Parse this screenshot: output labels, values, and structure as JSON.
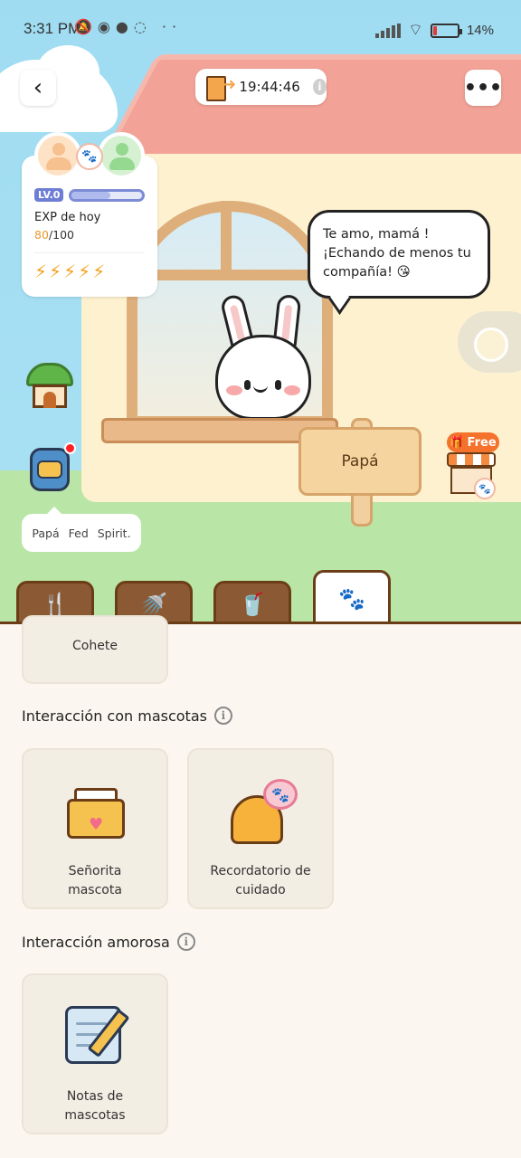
{
  "status_bar": {
    "time": "3:31 PM",
    "battery_text": "14%",
    "battery_level": 0.14
  },
  "header": {
    "timer": "19:44:46"
  },
  "profile": {
    "level": "LV.0",
    "level_progress": 0.55,
    "exp_label": "EXP de hoy",
    "exp_current": "80",
    "exp_total": "/100",
    "energy_bolts": 5
  },
  "speech_bubble": {
    "line1": "Te amo, mamá !",
    "line2": "¡Echando de menos tu",
    "line3": "compañía! 😘"
  },
  "notice": {
    "text": "Papá Fed Spirit."
  },
  "sign": {
    "label": "Papá"
  },
  "shop": {
    "badge": "Free"
  },
  "tabs": [
    {
      "icon": "food-icon",
      "active": false
    },
    {
      "icon": "shower-icon",
      "active": false
    },
    {
      "icon": "drink-icon",
      "active": false
    },
    {
      "icon": "pets-interaction-icon",
      "active": true
    }
  ],
  "panel": {
    "rocket_card": {
      "label": "Cohete"
    },
    "pet_interaction": {
      "title": "Interacción con mascotas",
      "items": [
        {
          "label_line1": "Señorita",
          "label_line2": "mascota",
          "icon": "letter-icon"
        },
        {
          "label_line1": "Recordatorio de",
          "label_line2": "cuidado",
          "icon": "bell-icon"
        }
      ]
    },
    "love_interaction": {
      "title": "Interacción amorosa",
      "items": [
        {
          "label_line1": "Notas de",
          "label_line2": "mascotas",
          "icon": "notes-icon"
        }
      ]
    }
  },
  "colors": {
    "accent_brown": "#6b3d17",
    "tab_brown": "#8b5a35",
    "exp_orange": "#e69a2e",
    "free_orange": "#f4722b"
  }
}
